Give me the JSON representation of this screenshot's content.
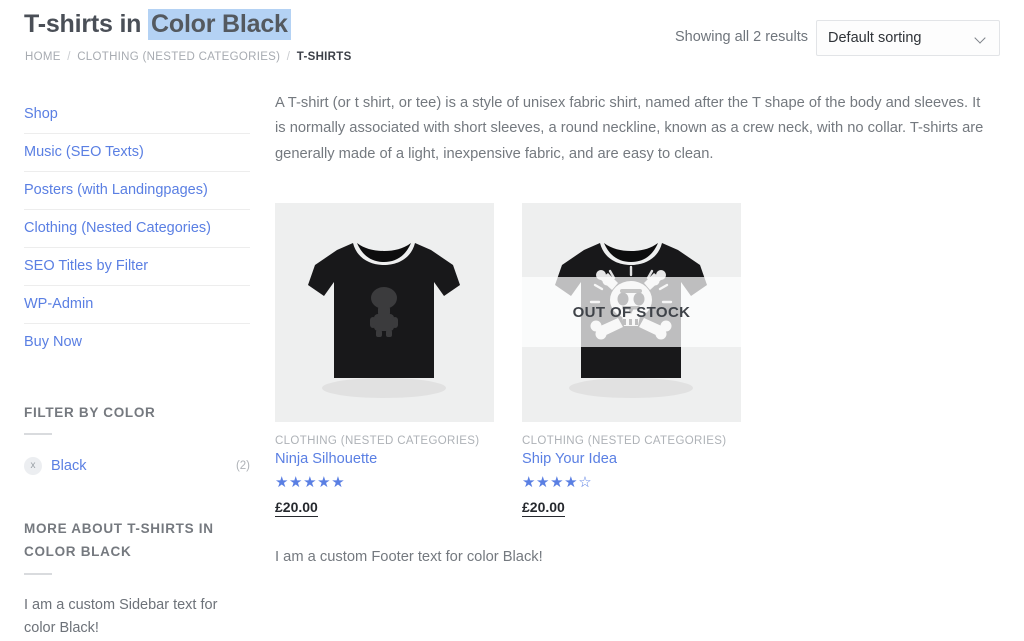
{
  "header": {
    "title_prefix": "T-shirts in ",
    "title_highlight": "Color Black",
    "breadcrumb": [
      {
        "label": "HOME",
        "current": false
      },
      {
        "label": "CLOTHING (NESTED CATEGORIES)",
        "current": false
      },
      {
        "label": "T-SHIRTS",
        "current": true
      }
    ],
    "breadcrumb_separator": "/",
    "result_count": "Showing all 2 results",
    "sort": {
      "selected": "Default sorting",
      "chevron_icon": "chevron-down-icon"
    }
  },
  "sidebar": {
    "nav": [
      {
        "label": "Shop"
      },
      {
        "label": "Music (SEO Texts)"
      },
      {
        "label": "Posters (with Landingpages)"
      },
      {
        "label": "Clothing (Nested Categories)"
      },
      {
        "label": "SEO Titles by Filter"
      },
      {
        "label": "WP-Admin"
      },
      {
        "label": "Buy Now"
      }
    ],
    "filter_widget": {
      "title": "FILTER BY COLOR",
      "items": [
        {
          "remove_icon": "x",
          "label": "Black",
          "count": "(2)"
        }
      ]
    },
    "about_widget": {
      "title": "MORE ABOUT T-SHIRTS IN COLOR BLACK",
      "text": "I am a custom Sidebar text for color Black!"
    }
  },
  "main": {
    "description": "A T-shirt (or t shirt, or tee) is a style of unisex fabric shirt, named after the T shape of the body and sleeves. It is normally associated with short sleeves, a round neckline, known as a crew neck, with no collar. T-shirts are generally made of a light, inexpensive fabric, and are easy to clean.",
    "products": [
      {
        "category": "CLOTHING (NESTED CATEGORIES)",
        "name": "Ninja Silhouette",
        "rating_full_stars": 5,
        "rating_half_star": false,
        "rating_empty_stars": 0,
        "price": "£20.00",
        "out_of_stock": false,
        "out_of_stock_label": "",
        "graphic": "ninja-silhouette"
      },
      {
        "category": "CLOTHING (NESTED CATEGORIES)",
        "name": "Ship Your Idea",
        "rating_full_stars": 4,
        "rating_half_star": true,
        "rating_empty_stars": 0,
        "price": "£20.00",
        "out_of_stock": true,
        "out_of_stock_label": "OUT OF STOCK",
        "graphic": "skull-crossbones"
      }
    ],
    "footer_text": "I am a custom Footer text for color Black!"
  },
  "colors": {
    "link": "#5a7fe3",
    "highlight": "#b4d2f4",
    "muted_text": "#74797f",
    "thumb_bg": "#eeefef",
    "star": "#5a7fe3"
  }
}
